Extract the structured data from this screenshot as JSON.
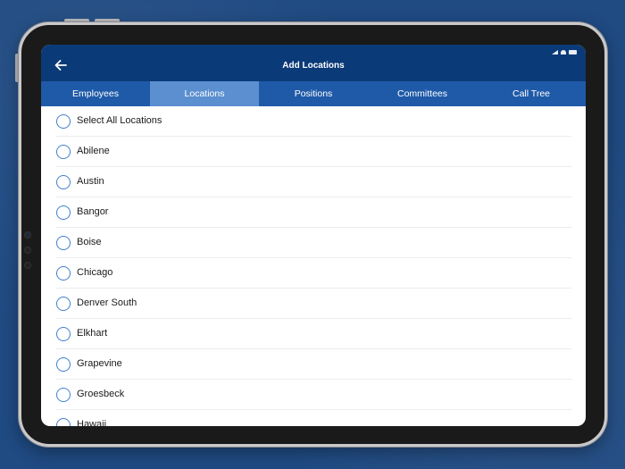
{
  "nav": {
    "title": "Add Locations"
  },
  "tabs": [
    {
      "label": "Employees",
      "active": false
    },
    {
      "label": "Locations",
      "active": true
    },
    {
      "label": "Positions",
      "active": false
    },
    {
      "label": "Committees",
      "active": false
    },
    {
      "label": "Call Tree",
      "active": false
    }
  ],
  "list": {
    "items": [
      {
        "label": "Select All Locations",
        "selected": false
      },
      {
        "label": "Abilene",
        "selected": false
      },
      {
        "label": "Austin",
        "selected": false
      },
      {
        "label": "Bangor",
        "selected": false
      },
      {
        "label": "Boise",
        "selected": false
      },
      {
        "label": "Chicago",
        "selected": false
      },
      {
        "label": "Denver South",
        "selected": false
      },
      {
        "label": "Elkhart",
        "selected": false
      },
      {
        "label": "Grapevine",
        "selected": false
      },
      {
        "label": "Groesbeck",
        "selected": false
      },
      {
        "label": "Hawaii",
        "selected": false
      }
    ]
  },
  "colors": {
    "navbar": "#0b3a78",
    "tabbar": "#1f5aa8",
    "tab_active": "#5b8fd0",
    "radio_border": "#3f7fcf",
    "background": "#1f4a82"
  },
  "icons": {
    "back": "back-arrow-icon",
    "radio": "radio-unchecked-icon"
  }
}
